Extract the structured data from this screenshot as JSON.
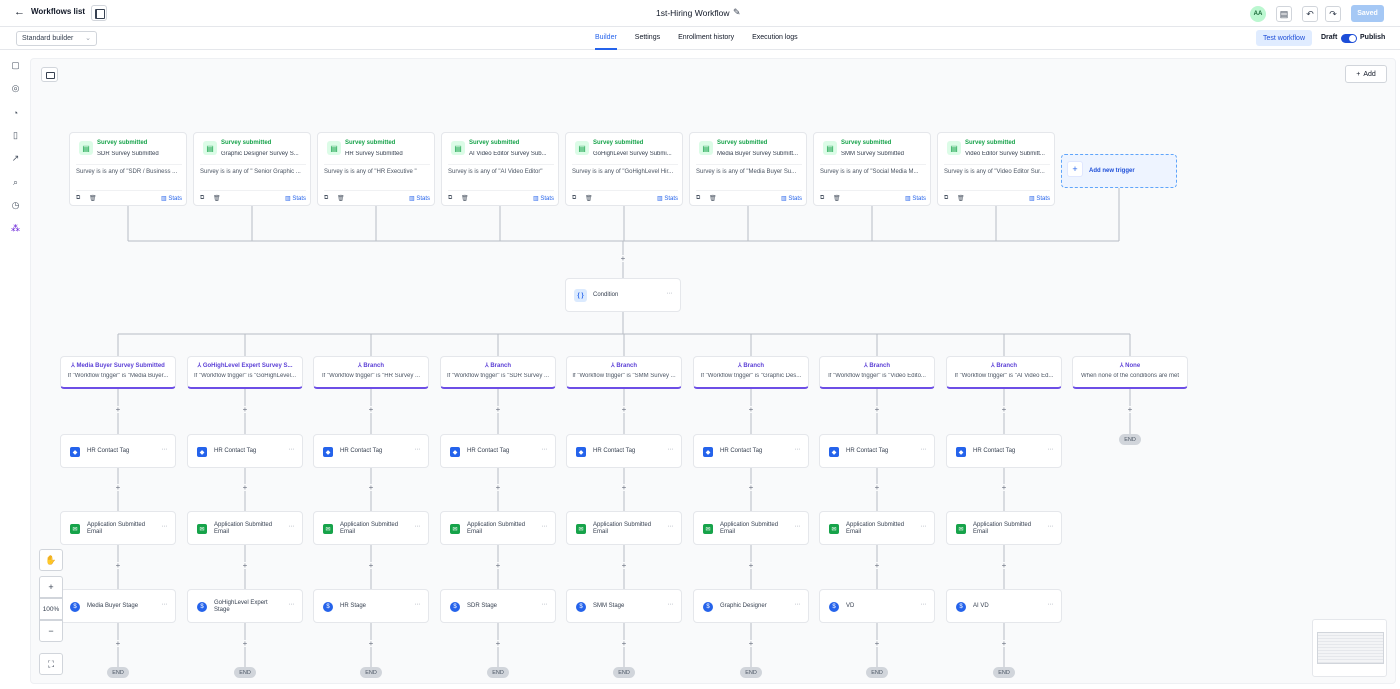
{
  "header": {
    "back_label": "Workflows list",
    "workflow_title": "1st-Hiring Workflow",
    "avatar_initials": "AA",
    "saved_label": "Saved"
  },
  "subbar": {
    "builder_select": "Standard builder",
    "tabs": [
      "Builder",
      "Settings",
      "Enrollment history",
      "Execution logs"
    ],
    "active_tab": "Builder",
    "test_label": "Test workflow",
    "draft_label": "Draft",
    "publish_label": "Publish"
  },
  "canvas": {
    "add_label": "Add",
    "zoom": "100%",
    "triggers": [
      {
        "type": "Survey submitted",
        "name": "SDR Survey Submitted",
        "cond": "Survey is is any of \"SDR / Business ...",
        "stats": "Stats"
      },
      {
        "type": "Survey submitted",
        "name": "Graphic Designer Survey S...",
        "cond": "Survey is is any of \" Senior Graphic ...",
        "stats": "Stats"
      },
      {
        "type": "Survey submitted",
        "name": "HR Survey Submitted",
        "cond": "Survey is is any of \"HR Executive \"",
        "stats": "Stats"
      },
      {
        "type": "Survey submitted",
        "name": "AI Video Editor Survey Sub...",
        "cond": "Survey is is any of \"AI Video Editor\"",
        "stats": "Stats"
      },
      {
        "type": "Survey submitted",
        "name": "GoHighLevel Survey Submi...",
        "cond": "Survey is is any of \"GoHighLevel Hir...",
        "stats": "Stats"
      },
      {
        "type": "Survey submitted",
        "name": "Media Buyer Survey Submitt...",
        "cond": "Survey is is any of \"Media Buyer Su...",
        "stats": "Stats"
      },
      {
        "type": "Survey submitted",
        "name": "SMM Survey Submitted",
        "cond": "Survey is is any of \"Social Media M...",
        "stats": "Stats"
      },
      {
        "type": "Survey submitted",
        "name": "Video Editor Survey Submitt...",
        "cond": "Survey is is any of \"Video Editor Sur...",
        "stats": "Stats"
      }
    ],
    "add_trigger_label": "Add new trigger",
    "condition_label": "Condition",
    "branches": [
      {
        "title": "Media Buyer Survey Submitted",
        "cond": "If \"Workflow trigger\" is \"Media Buyer..."
      },
      {
        "title": "GoHighLevel Expert Survey S...",
        "cond": "If \"Workflow trigger\" is \"GoHighLevel..."
      },
      {
        "title": "Branch",
        "cond": "If \"Workflow trigger\" is \"HR Survey ..."
      },
      {
        "title": "Branch",
        "cond": "If \"Workflow trigger\" is \"SDR Survey ..."
      },
      {
        "title": "Branch",
        "cond": "If \"Workflow trigger\" is \"SMM Survey ..."
      },
      {
        "title": "Branch",
        "cond": "If \"Workflow trigger\" is \"Graphic Des..."
      },
      {
        "title": "Branch",
        "cond": "If \"Workflow trigger\" is \"Video Edito..."
      },
      {
        "title": "Branch",
        "cond": "If \"Workflow trigger\" is \"AI Video Ed..."
      },
      {
        "title": "None",
        "cond": "When none of the conditions are met"
      }
    ],
    "tag_label": "HR Contact Tag",
    "email_label_1": "Application Submitted",
    "email_label_2": "Email",
    "stages": [
      "Media Buyer Stage",
      "GoHighLevel Expert Stage",
      "HR Stage",
      "SDR Stage",
      "SMM Stage",
      "Graphic Designer",
      "VD",
      "AI VD"
    ],
    "end_label": "END"
  },
  "colors": {
    "accent": "#2563eb",
    "branch": "#6d4ee6",
    "trigger": "#16a34a"
  }
}
